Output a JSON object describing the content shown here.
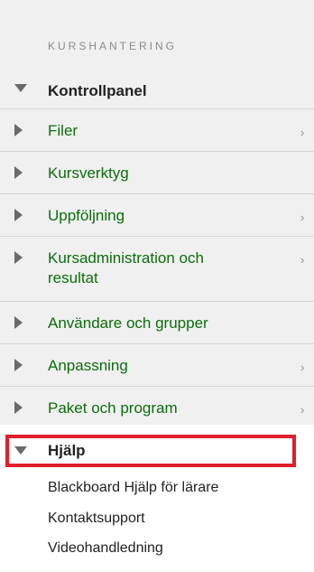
{
  "heading": "KURSHANTERING",
  "control_panel": {
    "label": "Kontrollpanel",
    "expanded": true
  },
  "menu_items": [
    {
      "label": "Filer",
      "has_submenu": true
    },
    {
      "label": "Kursverktyg",
      "has_submenu": false
    },
    {
      "label": "Uppföljning",
      "has_submenu": true
    },
    {
      "label": "Kursadministration och\nresultat",
      "has_submenu": true
    },
    {
      "label": "Användare och grupper",
      "has_submenu": false
    },
    {
      "label": "Anpassning",
      "has_submenu": true
    },
    {
      "label": "Paket och program",
      "has_submenu": true
    }
  ],
  "chevron_glyph": "›",
  "help": {
    "label": "Hjälp",
    "expanded": true,
    "highlight_color": "#e01e2c",
    "links": [
      {
        "label": "Blackboard Hjälp för lärare"
      },
      {
        "label": "Kontaktsupport"
      },
      {
        "label": "Videohandledning"
      }
    ]
  },
  "colors": {
    "link_green": "#0b6e0b",
    "menu_background": "#f0f0f0",
    "heading_gray": "#8a8a8a"
  }
}
